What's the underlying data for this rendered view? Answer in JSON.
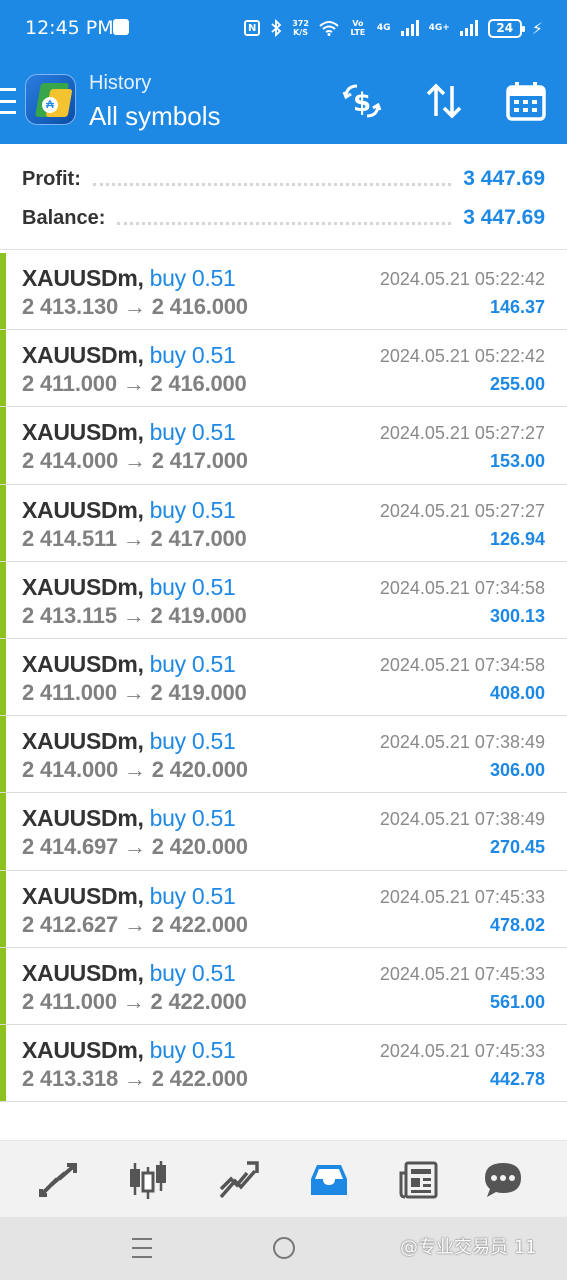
{
  "status_bar": {
    "time": "12:45 PM",
    "nfc": "N",
    "speed_value": "372",
    "speed_unit": "K/S",
    "volte": "Vo LTE",
    "net1": "4G",
    "net2": "4G+",
    "battery": "24"
  },
  "header": {
    "subtitle": "History",
    "title": "All symbols"
  },
  "summary": {
    "profit_label": "Profit:",
    "profit_value": "3 447.69",
    "balance_label": "Balance:",
    "balance_value": "3 447.69"
  },
  "deals": [
    {
      "symbol": "XAUUSDm,",
      "type": "buy 0.51",
      "open": "2 413.130",
      "arrow": "→",
      "close": "2 416.000",
      "time": "2024.05.21 05:22:42",
      "profit": "146.37"
    },
    {
      "symbol": "XAUUSDm,",
      "type": "buy 0.51",
      "open": "2 411.000",
      "arrow": "→",
      "close": "2 416.000",
      "time": "2024.05.21 05:22:42",
      "profit": "255.00"
    },
    {
      "symbol": "XAUUSDm,",
      "type": "buy 0.51",
      "open": "2 414.000",
      "arrow": "→",
      "close": "2 417.000",
      "time": "2024.05.21 05:27:27",
      "profit": "153.00"
    },
    {
      "symbol": "XAUUSDm,",
      "type": "buy 0.51",
      "open": "2 414.511",
      "arrow": "→",
      "close": "2 417.000",
      "time": "2024.05.21 05:27:27",
      "profit": "126.94"
    },
    {
      "symbol": "XAUUSDm,",
      "type": "buy 0.51",
      "open": "2 413.115",
      "arrow": "→",
      "close": "2 419.000",
      "time": "2024.05.21 07:34:58",
      "profit": "300.13"
    },
    {
      "symbol": "XAUUSDm,",
      "type": "buy 0.51",
      "open": "2 411.000",
      "arrow": "→",
      "close": "2 419.000",
      "time": "2024.05.21 07:34:58",
      "profit": "408.00"
    },
    {
      "symbol": "XAUUSDm,",
      "type": "buy 0.51",
      "open": "2 414.000",
      "arrow": "→",
      "close": "2 420.000",
      "time": "2024.05.21 07:38:49",
      "profit": "306.00"
    },
    {
      "symbol": "XAUUSDm,",
      "type": "buy 0.51",
      "open": "2 414.697",
      "arrow": "→",
      "close": "2 420.000",
      "time": "2024.05.21 07:38:49",
      "profit": "270.45"
    },
    {
      "symbol": "XAUUSDm,",
      "type": "buy 0.51",
      "open": "2 412.627",
      "arrow": "→",
      "close": "2 422.000",
      "time": "2024.05.21 07:45:33",
      "profit": "478.02"
    },
    {
      "symbol": "XAUUSDm,",
      "type": "buy 0.51",
      "open": "2 411.000",
      "arrow": "→",
      "close": "2 422.000",
      "time": "2024.05.21 07:45:33",
      "profit": "561.00"
    },
    {
      "symbol": "XAUUSDm,",
      "type": "buy 0.51",
      "open": "2 413.318",
      "arrow": "→",
      "close": "2 422.000",
      "time": "2024.05.21 07:45:33",
      "profit": "442.78"
    }
  ],
  "bottom_nav": [
    {
      "icon": "quotes-icon",
      "active": false
    },
    {
      "icon": "chart-icon",
      "active": false
    },
    {
      "icon": "trade-icon",
      "active": false
    },
    {
      "icon": "history-icon",
      "active": true
    },
    {
      "icon": "news-icon",
      "active": false
    },
    {
      "icon": "chat-icon",
      "active": false
    }
  ],
  "watermark": "@专业交易员 11",
  "colors": {
    "primary": "#1e88e5",
    "buy_bar": "#8cc21f",
    "muted_text": "#808080",
    "nav_icon": "#555555"
  }
}
